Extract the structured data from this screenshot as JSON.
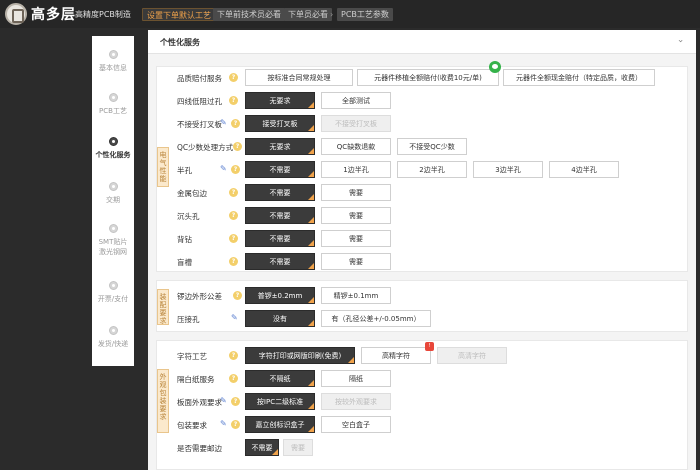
{
  "header": {
    "brand": "高多层",
    "brand_sub": "高精度PCB制造",
    "breadcrumbs": [
      "设置下单默认工艺",
      "下单前技术员必看",
      "下单员必看",
      "PCB工艺参数"
    ]
  },
  "sidebar": {
    "steps": [
      "基本信息",
      "PCB工艺",
      "个性化服务",
      "交期",
      "SMT贴片 激光钢网",
      "开票/支付",
      "发货/快递"
    ],
    "active_index": 2
  },
  "panel": {
    "title": "个性化服务",
    "groups": [
      {
        "tag": "电气性能"
      },
      {
        "tag": "装配要求"
      },
      {
        "tag": "外观包装要求"
      }
    ],
    "rows": [
      {
        "label": "品质赔付服务",
        "options": [
          "按标准合同常规处理",
          "元器件移植全额赔付(收费10元/单)",
          "元器件全额现金赔付（特定品质，收费）"
        ]
      },
      {
        "label": "四线低阻过孔",
        "options": [
          "无要求",
          "全部测试"
        ]
      },
      {
        "label": "不接受打叉板",
        "options": [
          "接受打叉板",
          "不接受打叉板"
        ]
      },
      {
        "label": "QC少数处理方式",
        "options": [
          "无要求",
          "QC缺数退款",
          "不接受QC少数"
        ]
      },
      {
        "label": "半孔",
        "options": [
          "不需要",
          "1边半孔",
          "2边半孔",
          "3边半孔",
          "4边半孔"
        ]
      },
      {
        "label": "金属包边",
        "options": [
          "不需要",
          "需要"
        ]
      },
      {
        "label": "沉头孔",
        "options": [
          "不需要",
          "需要"
        ]
      },
      {
        "label": "背钻",
        "options": [
          "不需要",
          "需要"
        ]
      },
      {
        "label": "盲槽",
        "options": [
          "不需要",
          "需要"
        ]
      },
      {
        "label": "锣边外形公差",
        "options": [
          "普锣±0.2mm",
          "精锣±0.1mm"
        ]
      },
      {
        "label": "压接孔",
        "options": [
          "没有",
          "有（孔径公差+/-0.05mm）"
        ]
      },
      {
        "label": "字符工艺",
        "options": [
          "字符打印或网版印刷(免费)",
          "高精字符",
          "高清字符"
        ]
      },
      {
        "label": "隔白纸服务",
        "options": [
          "不隔纸",
          "隔纸"
        ]
      },
      {
        "label": "板面外观要求",
        "options": [
          "按IPC二级标准",
          "按较外观要求"
        ]
      },
      {
        "label": "包装要求",
        "options": [
          "嘉立创标识盒子",
          "空白盒子"
        ]
      },
      {
        "label": "是否需要邮边",
        "options": [
          "不需要",
          "需要"
        ]
      }
    ]
  }
}
